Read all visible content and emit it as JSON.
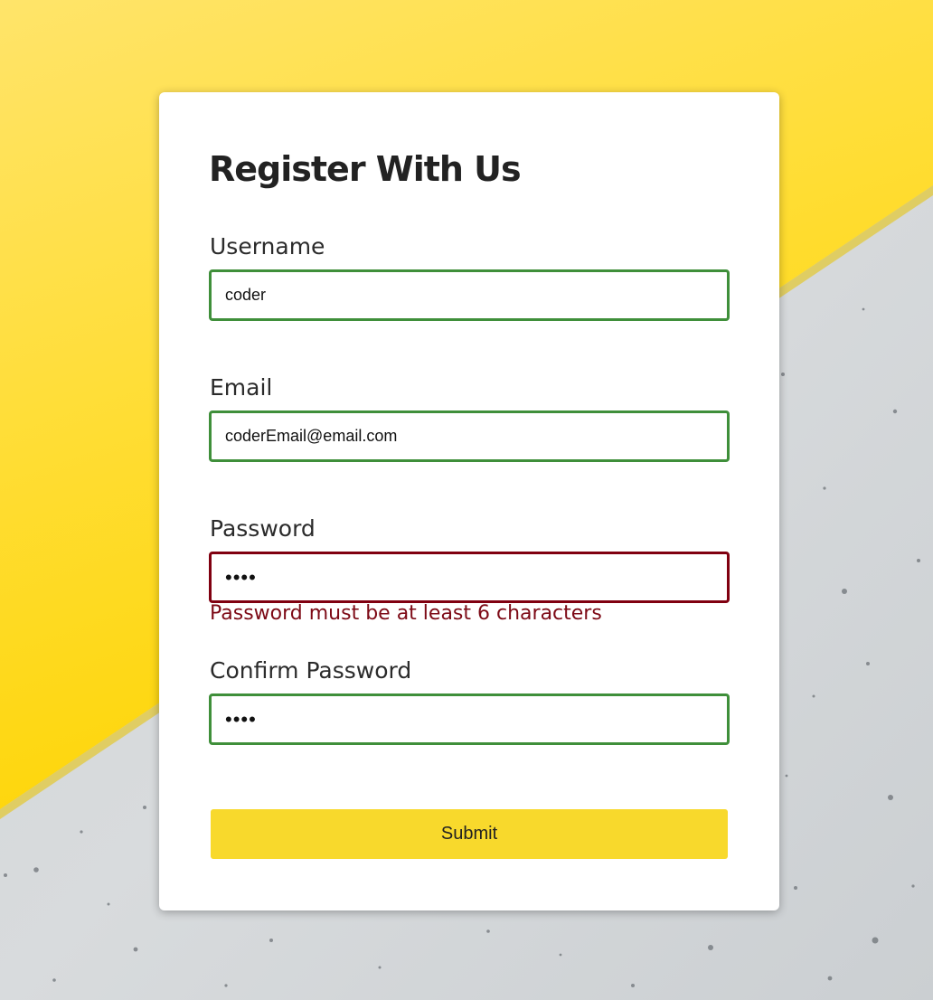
{
  "form": {
    "title": "Register With Us",
    "username": {
      "label": "Username",
      "value": "coder",
      "valid": true
    },
    "email": {
      "label": "Email",
      "value": "coderEmail@email.com",
      "valid": true
    },
    "password": {
      "label": "Password",
      "value": "abcd",
      "valid": false,
      "error": "Password must be at least 6 characters"
    },
    "confirm_password": {
      "label": "Confirm Password",
      "value": "abcd",
      "valid": true
    },
    "submit_label": "Submit"
  },
  "colors": {
    "valid_border": "#3f8f3a",
    "error_border": "#800010",
    "error_text": "#7d0a16",
    "button_bg": "#f8d92c",
    "bg_yellow": "#fed900",
    "bg_concrete": "#d5d8da"
  }
}
